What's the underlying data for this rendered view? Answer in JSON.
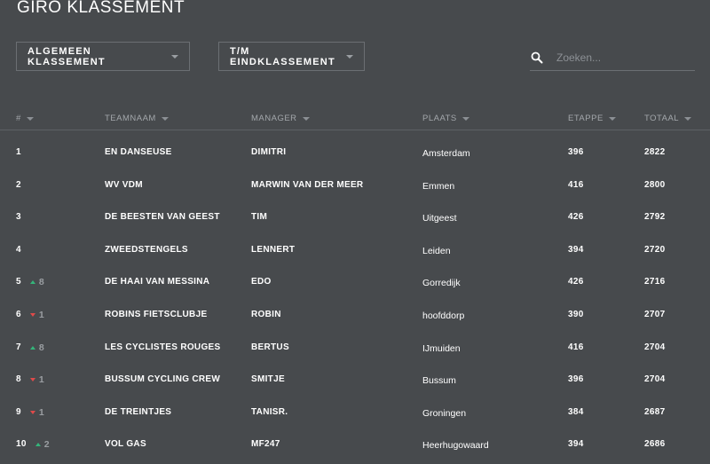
{
  "page": {
    "title": "GIRO KLASSEMENT"
  },
  "filters": {
    "klassement_label": "ALGEMEEN KLASSEMENT",
    "eind_label": "T/M EINDKLASSEMENT"
  },
  "search": {
    "placeholder": "Zoeken..."
  },
  "colors": {
    "background": "#474a4d",
    "up": "#34b57a",
    "down": "#e04a4a"
  },
  "table": {
    "headers": [
      "#",
      "TEAMNAAM",
      "MANAGER",
      "PLAATS",
      "ETAPPE",
      "TOTAAL"
    ],
    "rows": [
      {
        "rank": "1",
        "trend": "",
        "change": "",
        "team": "EN DANSEUSE",
        "manager": "DIMITRI",
        "plaats": "Amsterdam",
        "etappe": "396",
        "totaal": "2822"
      },
      {
        "rank": "2",
        "trend": "",
        "change": "",
        "team": "WV VDM",
        "manager": "MARWIN VAN DER MEER",
        "plaats": "Emmen",
        "etappe": "416",
        "totaal": "2800"
      },
      {
        "rank": "3",
        "trend": "",
        "change": "",
        "team": "DE BEESTEN VAN GEEST",
        "manager": "TIM",
        "plaats": "Uitgeest",
        "etappe": "426",
        "totaal": "2792"
      },
      {
        "rank": "4",
        "trend": "",
        "change": "",
        "team": "ZWEEDSTENGELS",
        "manager": "LENNERT",
        "plaats": "Leiden",
        "etappe": "394",
        "totaal": "2720"
      },
      {
        "rank": "5",
        "trend": "up",
        "change": "8",
        "team": "DE HAAI VAN MESSINA",
        "manager": "EDO",
        "plaats": "Gorredijk",
        "etappe": "426",
        "totaal": "2716"
      },
      {
        "rank": "6",
        "trend": "down",
        "change": "1",
        "team": "ROBINS FIETSCLUBJE",
        "manager": "ROBIN",
        "plaats": "hoofddorp",
        "etappe": "390",
        "totaal": "2707"
      },
      {
        "rank": "7",
        "trend": "up",
        "change": "8",
        "team": "LES CYCLISTES ROUGES",
        "manager": "BERTUS",
        "plaats": "IJmuiden",
        "etappe": "416",
        "totaal": "2704"
      },
      {
        "rank": "8",
        "trend": "down",
        "change": "1",
        "team": "BUSSUM CYCLING CREW",
        "manager": "SMITJE",
        "plaats": "Bussum",
        "etappe": "396",
        "totaal": "2704"
      },
      {
        "rank": "9",
        "trend": "down",
        "change": "1",
        "team": "DE TREINTJES",
        "manager": "TANISR.",
        "plaats": "Groningen",
        "etappe": "384",
        "totaal": "2687"
      },
      {
        "rank": "10",
        "trend": "up",
        "change": "2",
        "team": "VOL GAS",
        "manager": "MF247",
        "plaats": "Heerhugowaard",
        "etappe": "394",
        "totaal": "2686"
      }
    ]
  }
}
